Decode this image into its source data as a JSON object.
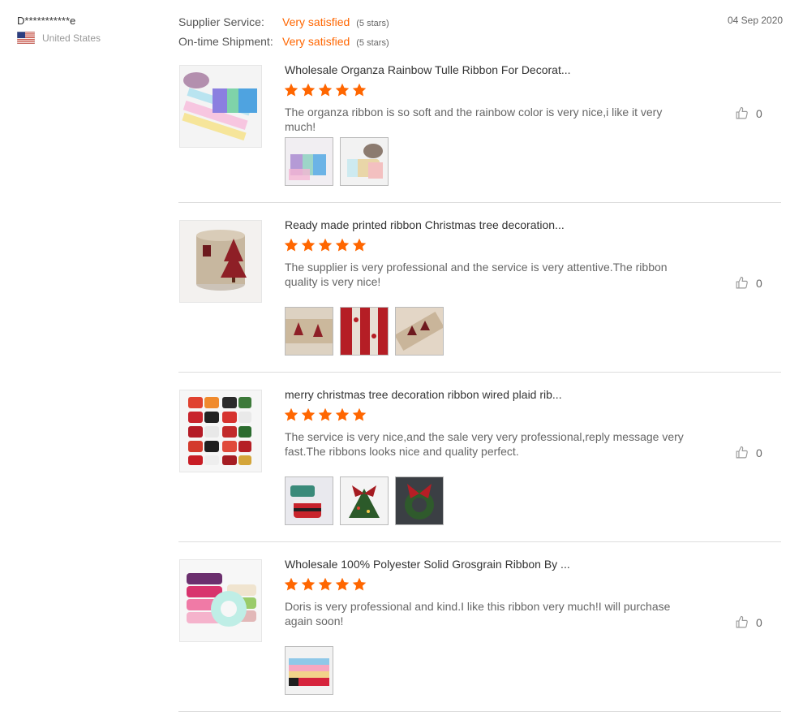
{
  "reviewer": {
    "name": "D***********e",
    "country": "United States"
  },
  "date": "04 Sep 2020",
  "ratings": [
    {
      "label": "Supplier Service:",
      "value": "Very satisfied",
      "stars": "(5 stars)"
    },
    {
      "label": "On-time Shipment:",
      "value": "Very satisfied",
      "stars": "(5 stars)"
    }
  ],
  "reviews": [
    {
      "title": "Wholesale Organza Rainbow Tulle Ribbon For Decorat...",
      "rating": 5,
      "text": "The organza ribbon is so soft and the rainbow color is very nice,i like it very much!",
      "likes": "0",
      "photo_count": 2
    },
    {
      "title": "Ready made printed ribbon Christmas tree decoration...",
      "rating": 5,
      "text": "The supplier is very professional and the service is very attentive.The ribbon quality is very nice!",
      "likes": "0",
      "photo_count": 3
    },
    {
      "title": "merry christmas tree decoration ribbon wired plaid rib...",
      "rating": 5,
      "text": "The service is very nice,and the sale very very professional,reply message very fast.The ribbons looks nice and quality perfect.",
      "likes": "0",
      "photo_count": 3
    },
    {
      "title": "Wholesale 100% Polyester Solid Grosgrain Ribbon By ...",
      "rating": 5,
      "text": "Doris is very professional and kind.I like this ribbon very much!I will purchase again soon!",
      "likes": "0",
      "photo_count": 1
    }
  ],
  "colors": {
    "accent": "#ff6600",
    "border": "#dddddd",
    "muted": "#999999"
  },
  "icons": {
    "flag": "us-flag-icon",
    "star": "star-icon",
    "like": "thumbs-up-icon"
  }
}
